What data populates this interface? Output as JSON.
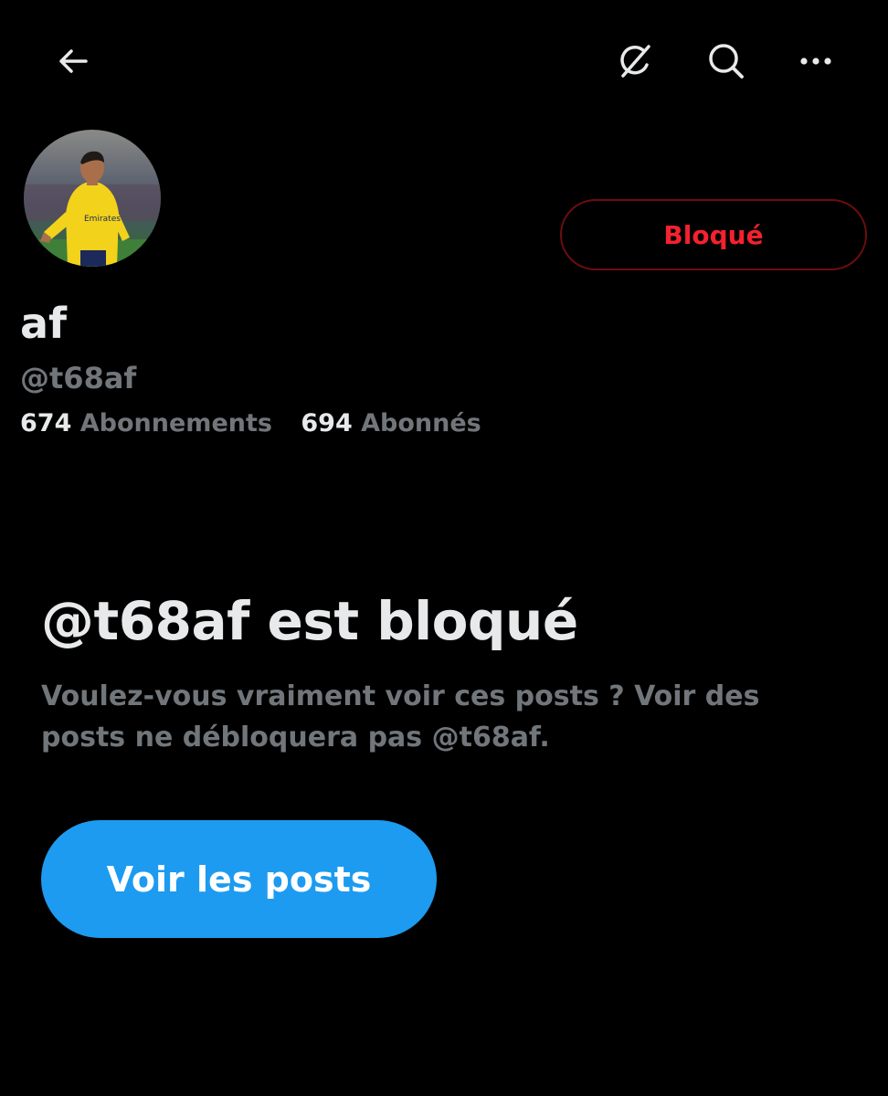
{
  "header": {
    "back_icon": "arrow-left-icon",
    "grok_icon": "grok-icon",
    "search_icon": "search-icon",
    "more_icon": "more-horizontal-icon"
  },
  "profile": {
    "avatar": "profile-photo",
    "display_name": "af",
    "handle": "@t68af",
    "blocked_button_label": "Bloqué",
    "following_count": "674",
    "following_label": "Abonnements",
    "followers_count": "694",
    "followers_label": "Abonnés"
  },
  "blocked_notice": {
    "title": "@t68af est bloqué",
    "description": "Voulez-vous vraiment voir ces posts ? Voir des posts ne débloquera pas @t68af.",
    "view_posts_label": "Voir les posts"
  },
  "colors": {
    "background": "#000000",
    "text_primary": "#e7e9ea",
    "text_secondary": "#71767b",
    "blocked_red": "#f4212e",
    "accent_blue": "#1d9bf0"
  }
}
